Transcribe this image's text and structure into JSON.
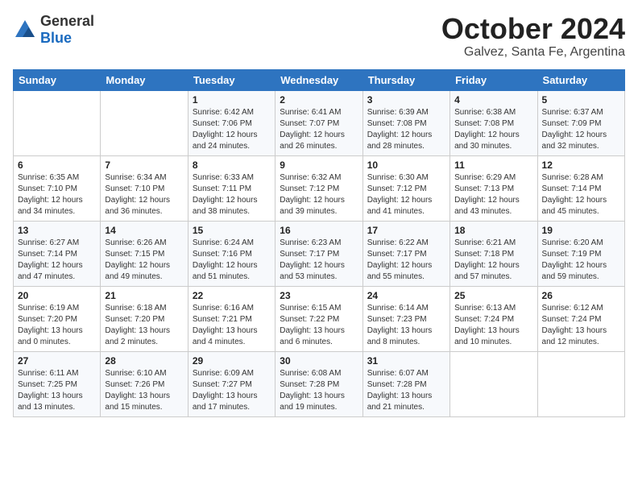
{
  "header": {
    "logo_general": "General",
    "logo_blue": "Blue",
    "title": "October 2024",
    "subtitle": "Galvez, Santa Fe, Argentina"
  },
  "weekdays": [
    "Sunday",
    "Monday",
    "Tuesday",
    "Wednesday",
    "Thursday",
    "Friday",
    "Saturday"
  ],
  "weeks": [
    [
      {
        "day": "",
        "sunrise": "",
        "sunset": "",
        "daylight": ""
      },
      {
        "day": "",
        "sunrise": "",
        "sunset": "",
        "daylight": ""
      },
      {
        "day": "1",
        "sunrise": "Sunrise: 6:42 AM",
        "sunset": "Sunset: 7:06 PM",
        "daylight": "Daylight: 12 hours and 24 minutes."
      },
      {
        "day": "2",
        "sunrise": "Sunrise: 6:41 AM",
        "sunset": "Sunset: 7:07 PM",
        "daylight": "Daylight: 12 hours and 26 minutes."
      },
      {
        "day": "3",
        "sunrise": "Sunrise: 6:39 AM",
        "sunset": "Sunset: 7:08 PM",
        "daylight": "Daylight: 12 hours and 28 minutes."
      },
      {
        "day": "4",
        "sunrise": "Sunrise: 6:38 AM",
        "sunset": "Sunset: 7:08 PM",
        "daylight": "Daylight: 12 hours and 30 minutes."
      },
      {
        "day": "5",
        "sunrise": "Sunrise: 6:37 AM",
        "sunset": "Sunset: 7:09 PM",
        "daylight": "Daylight: 12 hours and 32 minutes."
      }
    ],
    [
      {
        "day": "6",
        "sunrise": "Sunrise: 6:35 AM",
        "sunset": "Sunset: 7:10 PM",
        "daylight": "Daylight: 12 hours and 34 minutes."
      },
      {
        "day": "7",
        "sunrise": "Sunrise: 6:34 AM",
        "sunset": "Sunset: 7:10 PM",
        "daylight": "Daylight: 12 hours and 36 minutes."
      },
      {
        "day": "8",
        "sunrise": "Sunrise: 6:33 AM",
        "sunset": "Sunset: 7:11 PM",
        "daylight": "Daylight: 12 hours and 38 minutes."
      },
      {
        "day": "9",
        "sunrise": "Sunrise: 6:32 AM",
        "sunset": "Sunset: 7:12 PM",
        "daylight": "Daylight: 12 hours and 39 minutes."
      },
      {
        "day": "10",
        "sunrise": "Sunrise: 6:30 AM",
        "sunset": "Sunset: 7:12 PM",
        "daylight": "Daylight: 12 hours and 41 minutes."
      },
      {
        "day": "11",
        "sunrise": "Sunrise: 6:29 AM",
        "sunset": "Sunset: 7:13 PM",
        "daylight": "Daylight: 12 hours and 43 minutes."
      },
      {
        "day": "12",
        "sunrise": "Sunrise: 6:28 AM",
        "sunset": "Sunset: 7:14 PM",
        "daylight": "Daylight: 12 hours and 45 minutes."
      }
    ],
    [
      {
        "day": "13",
        "sunrise": "Sunrise: 6:27 AM",
        "sunset": "Sunset: 7:14 PM",
        "daylight": "Daylight: 12 hours and 47 minutes."
      },
      {
        "day": "14",
        "sunrise": "Sunrise: 6:26 AM",
        "sunset": "Sunset: 7:15 PM",
        "daylight": "Daylight: 12 hours and 49 minutes."
      },
      {
        "day": "15",
        "sunrise": "Sunrise: 6:24 AM",
        "sunset": "Sunset: 7:16 PM",
        "daylight": "Daylight: 12 hours and 51 minutes."
      },
      {
        "day": "16",
        "sunrise": "Sunrise: 6:23 AM",
        "sunset": "Sunset: 7:17 PM",
        "daylight": "Daylight: 12 hours and 53 minutes."
      },
      {
        "day": "17",
        "sunrise": "Sunrise: 6:22 AM",
        "sunset": "Sunset: 7:17 PM",
        "daylight": "Daylight: 12 hours and 55 minutes."
      },
      {
        "day": "18",
        "sunrise": "Sunrise: 6:21 AM",
        "sunset": "Sunset: 7:18 PM",
        "daylight": "Daylight: 12 hours and 57 minutes."
      },
      {
        "day": "19",
        "sunrise": "Sunrise: 6:20 AM",
        "sunset": "Sunset: 7:19 PM",
        "daylight": "Daylight: 12 hours and 59 minutes."
      }
    ],
    [
      {
        "day": "20",
        "sunrise": "Sunrise: 6:19 AM",
        "sunset": "Sunset: 7:20 PM",
        "daylight": "Daylight: 13 hours and 0 minutes."
      },
      {
        "day": "21",
        "sunrise": "Sunrise: 6:18 AM",
        "sunset": "Sunset: 7:20 PM",
        "daylight": "Daylight: 13 hours and 2 minutes."
      },
      {
        "day": "22",
        "sunrise": "Sunrise: 6:16 AM",
        "sunset": "Sunset: 7:21 PM",
        "daylight": "Daylight: 13 hours and 4 minutes."
      },
      {
        "day": "23",
        "sunrise": "Sunrise: 6:15 AM",
        "sunset": "Sunset: 7:22 PM",
        "daylight": "Daylight: 13 hours and 6 minutes."
      },
      {
        "day": "24",
        "sunrise": "Sunrise: 6:14 AM",
        "sunset": "Sunset: 7:23 PM",
        "daylight": "Daylight: 13 hours and 8 minutes."
      },
      {
        "day": "25",
        "sunrise": "Sunrise: 6:13 AM",
        "sunset": "Sunset: 7:24 PM",
        "daylight": "Daylight: 13 hours and 10 minutes."
      },
      {
        "day": "26",
        "sunrise": "Sunrise: 6:12 AM",
        "sunset": "Sunset: 7:24 PM",
        "daylight": "Daylight: 13 hours and 12 minutes."
      }
    ],
    [
      {
        "day": "27",
        "sunrise": "Sunrise: 6:11 AM",
        "sunset": "Sunset: 7:25 PM",
        "daylight": "Daylight: 13 hours and 13 minutes."
      },
      {
        "day": "28",
        "sunrise": "Sunrise: 6:10 AM",
        "sunset": "Sunset: 7:26 PM",
        "daylight": "Daylight: 13 hours and 15 minutes."
      },
      {
        "day": "29",
        "sunrise": "Sunrise: 6:09 AM",
        "sunset": "Sunset: 7:27 PM",
        "daylight": "Daylight: 13 hours and 17 minutes."
      },
      {
        "day": "30",
        "sunrise": "Sunrise: 6:08 AM",
        "sunset": "Sunset: 7:28 PM",
        "daylight": "Daylight: 13 hours and 19 minutes."
      },
      {
        "day": "31",
        "sunrise": "Sunrise: 6:07 AM",
        "sunset": "Sunset: 7:28 PM",
        "daylight": "Daylight: 13 hours and 21 minutes."
      },
      {
        "day": "",
        "sunrise": "",
        "sunset": "",
        "daylight": ""
      },
      {
        "day": "",
        "sunrise": "",
        "sunset": "",
        "daylight": ""
      }
    ]
  ]
}
